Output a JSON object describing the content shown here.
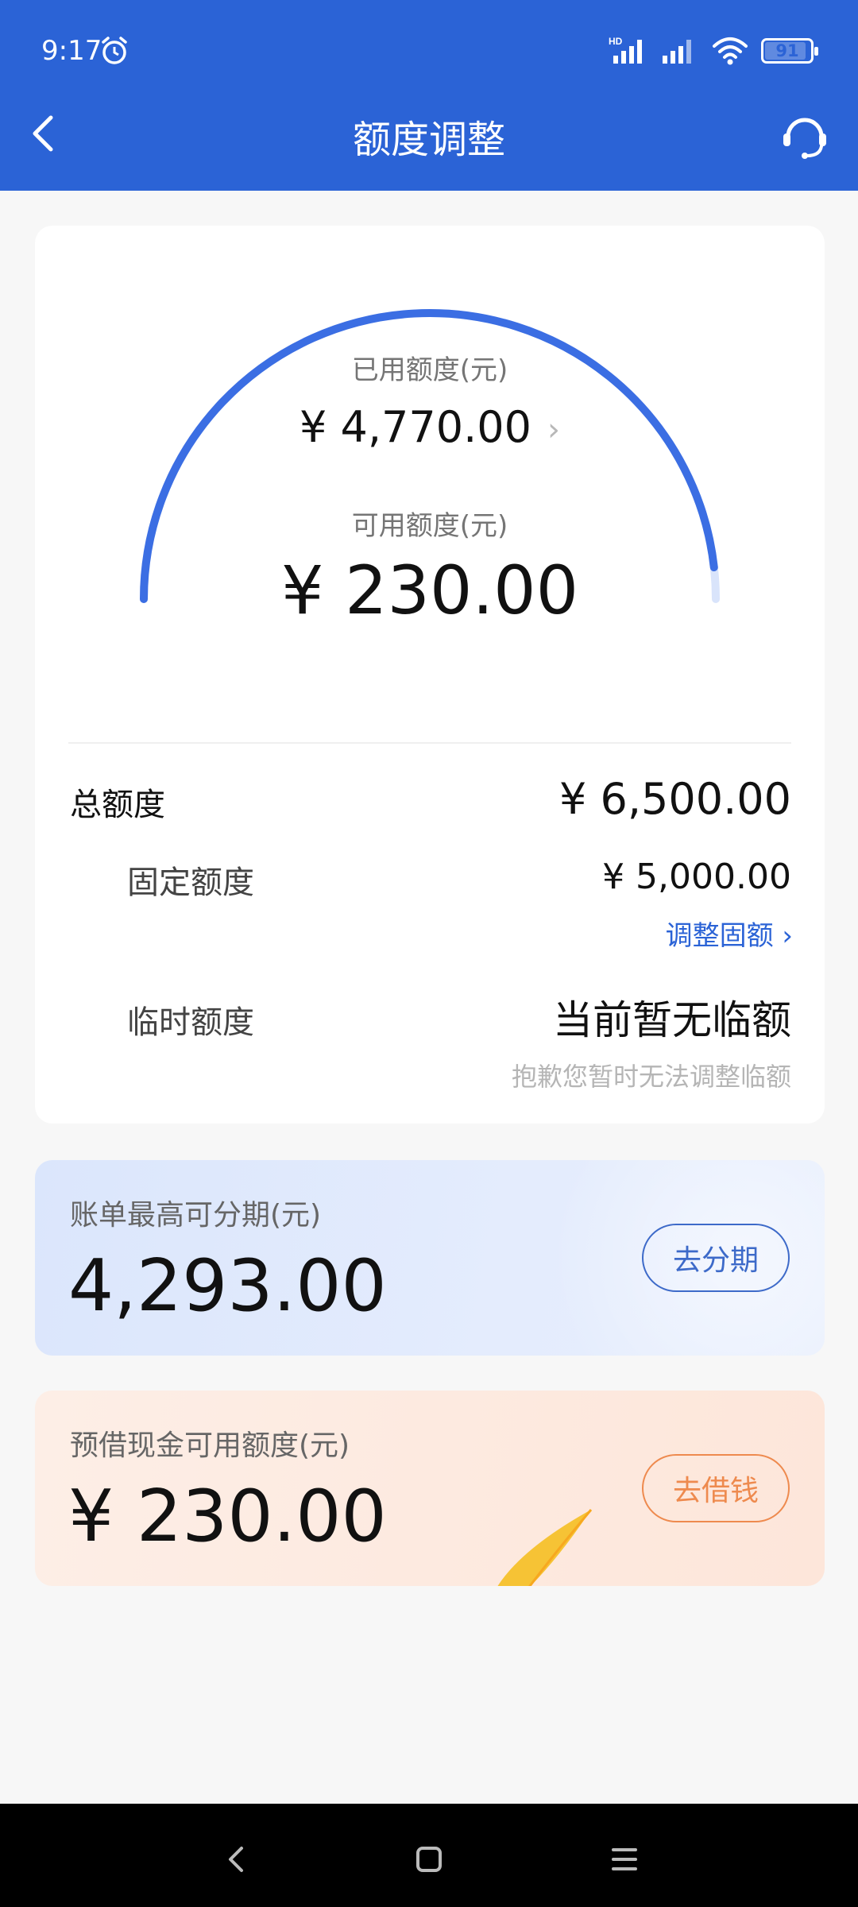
{
  "status_bar": {
    "time": "9:17",
    "battery": "91",
    "battery_level": 0.91,
    "icons": [
      "alarm-icon",
      "hd-signal-icon",
      "signal-icon",
      "wifi-icon",
      "battery-icon"
    ]
  },
  "header": {
    "title": "额度调整",
    "back_icon": "back-arrow-icon",
    "service_icon": "customer-service-icon",
    "color": "#2b63d6"
  },
  "gauge": {
    "used_label": "已用额度(元)",
    "used_value": "¥ 4,770.00",
    "available_label": "可用额度(元)",
    "available_value": "¥ 230.00",
    "used_ratio": 0.9646
  },
  "quota": {
    "total_label": "总额度",
    "total_value": "¥ 6,500.00",
    "fixed_label": "固定额度",
    "fixed_value": "¥ 5,000.00",
    "adjust_link": "调整固额",
    "temp_label": "临时额度",
    "temp_value": "当前暂无临额",
    "temp_note": "抱歉您暂时无法调整临额"
  },
  "installment": {
    "label": "账单最高可分期(元)",
    "value": "4,293.00",
    "button": "去分期"
  },
  "cash": {
    "label": "预借现金可用额度(元)",
    "value": "¥ 230.00",
    "button": "去借钱"
  },
  "navbar": {
    "icons": [
      "nav-back-icon",
      "nav-home-icon",
      "nav-menu-icon"
    ]
  }
}
